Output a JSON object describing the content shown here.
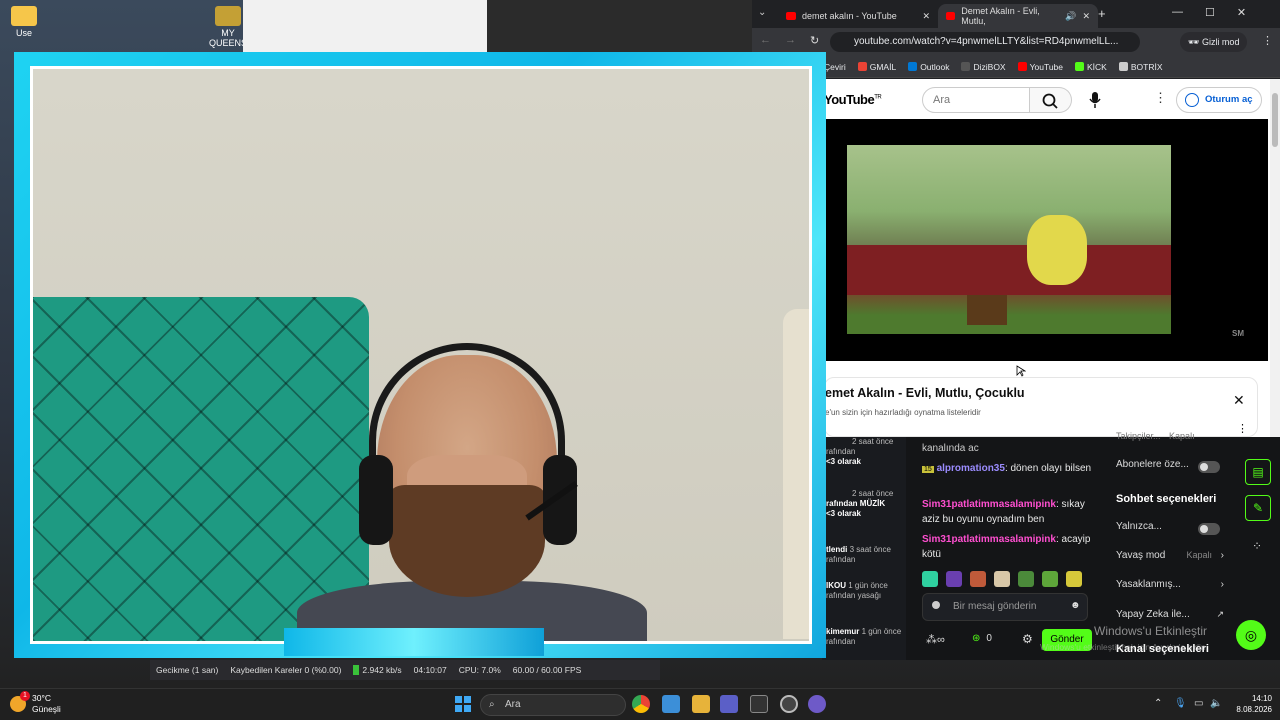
{
  "desktop": {
    "icons": [
      {
        "label": "Use"
      },
      {
        "label": "MY QUEENS"
      }
    ]
  },
  "browser": {
    "tabs": [
      {
        "title": "demet akalın - YouTube"
      },
      {
        "title": "Demet Akalın - Evli, Mutlu,"
      }
    ],
    "url": "youtube.com/watch?v=4pnwmelLLTY&list=RD4pnwmelLL...",
    "incognito_label": "Gizli mod",
    "bookmarks": [
      {
        "label": "Çeviri",
        "color": "#4285f4"
      },
      {
        "label": "GMAİL",
        "color": "#ea4335"
      },
      {
        "label": "Outlook",
        "color": "#0078d4"
      },
      {
        "label": "DiziBOX",
        "color": "#222222"
      },
      {
        "label": "YouTube",
        "color": "#ff0000"
      },
      {
        "label": "KİCK",
        "color": "#53fc18"
      },
      {
        "label": "BOTRİX",
        "color": "#cccccc"
      }
    ]
  },
  "youtube": {
    "logo": "YouTube",
    "logo_region": "TR",
    "search_placeholder": "Ara",
    "signin_label": "Oturum aç",
    "video_watermark": "SM",
    "video_title": "emet Akalın - Evli, Mutlu, Çocuklu",
    "playlist_subtitle": "e'un sizin için hazırladığı oynatma listeleridir"
  },
  "kick": {
    "events": [
      {
        "name": "",
        "time": "2 saat önce",
        "line2": "rafından",
        "line3": "<3 olarak"
      },
      {
        "name": "",
        "time": "2 saat önce",
        "line2": "rafından MÜZİK",
        "line3": "<3 olarak"
      },
      {
        "name": "tlendi",
        "time": "3 saat önce",
        "line2": "rafından",
        "line3": ""
      },
      {
        "name": "IKOU",
        "time": "1 gün önce",
        "line2": "rafından yasağı",
        "line3": ""
      },
      {
        "name": "kimemur",
        "time": "1 gün önce",
        "line2": "rafından",
        "line3": ""
      }
    ],
    "chat": {
      "top_fragment": "kanalında ac",
      "messages": [
        {
          "badge": "15",
          "user": "alpromation35",
          "text": ": dönen olayı bilsen",
          "style": "u1"
        },
        {
          "badge": "",
          "user": "Sim31patlatimmasalamipink",
          "text": ": sıkay aziz bu oyunu oynadım ben",
          "style": "u2"
        },
        {
          "badge": "",
          "user": "Sim31patlatimmasalamipink",
          "text": ": acayip kötü",
          "style": "u2"
        }
      ],
      "input_placeholder": "Bir mesaj gönderin",
      "viewer_count": "0",
      "send_label": "Gönder"
    },
    "settings": {
      "top_fragment": "Takipçiler...",
      "top_fragment_value": "Kapalı",
      "subs_label": "Abonelere öze...",
      "section_title": "Sohbet seçenekleri",
      "only_label": "Yalnızca...",
      "slow_label": "Yavaş mod",
      "slow_value": "Kapalı",
      "banned_label": "Yasaklanmış...",
      "ai_label": "Yapay Zeka ile...",
      "channel_label": "Kanal seçenekleri"
    }
  },
  "obs": {
    "delay": "Gecikme (1 san)",
    "dropped": "Kaybedilen Kareler 0 (%0.00)",
    "bitrate": "2.942 kb/s",
    "time": "04:10:07",
    "cpu": "CPU: 7.0%",
    "fps": "60.00 / 60.00 FPS"
  },
  "watermark": {
    "title": "Windows'u Etkinleştir",
    "subtitle": "Windows'u etkinleştirmek için Ayarlar'a gidin."
  },
  "taskbar": {
    "temp": "30°C",
    "weather": "Güneşli",
    "search_placeholder": "Ara",
    "notif_count": "1",
    "time": "14:10",
    "date": "8.08.2026"
  }
}
